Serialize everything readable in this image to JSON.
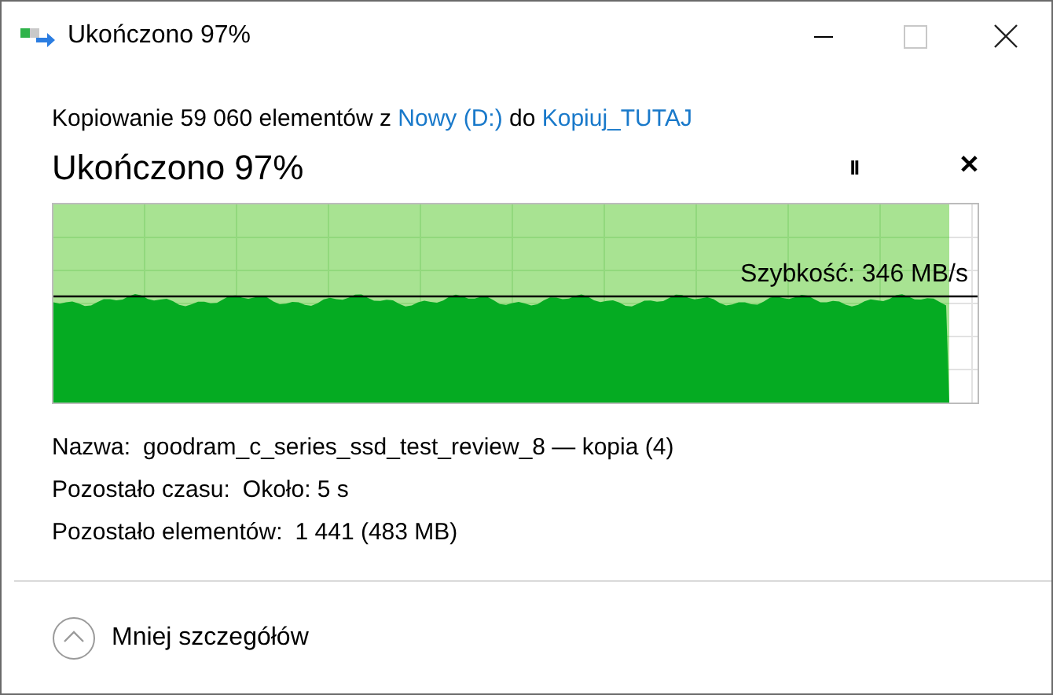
{
  "window": {
    "title": "Ukończono 97%",
    "controls": [
      {
        "kind": "minimize"
      },
      {
        "kind": "maximize"
      },
      {
        "kind": "close"
      }
    ]
  },
  "description": [
    {
      "kind": "text",
      "text": "Kopiowanie 59 060 elementów z "
    },
    {
      "kind": "link",
      "text": "Nowy (D:)"
    },
    {
      "kind": "text",
      "text": " do "
    },
    {
      "kind": "link",
      "text": "Kopiuj_TUTAJ"
    }
  ],
  "heading": "Ukończono 97%",
  "actions": [
    {
      "kind": "pause",
      "label": "II"
    },
    {
      "kind": "cancel",
      "label": "✕"
    }
  ],
  "progress": {
    "level": 0.97,
    "speed": "Szybkość: 346 MB/s"
  },
  "details": [
    {
      "label": "Nazwa:",
      "value": "goodram_c_series_ssd_test_review_8 — kopia (4)"
    },
    {
      "label": "Pozostało czasu:",
      "value": "Około: 5 s"
    },
    {
      "label": "Pozostało elementów:",
      "value": "1 441 (483 MB)"
    }
  ],
  "footer": {
    "label": "Mniej szczegółów",
    "expanded": true
  }
}
